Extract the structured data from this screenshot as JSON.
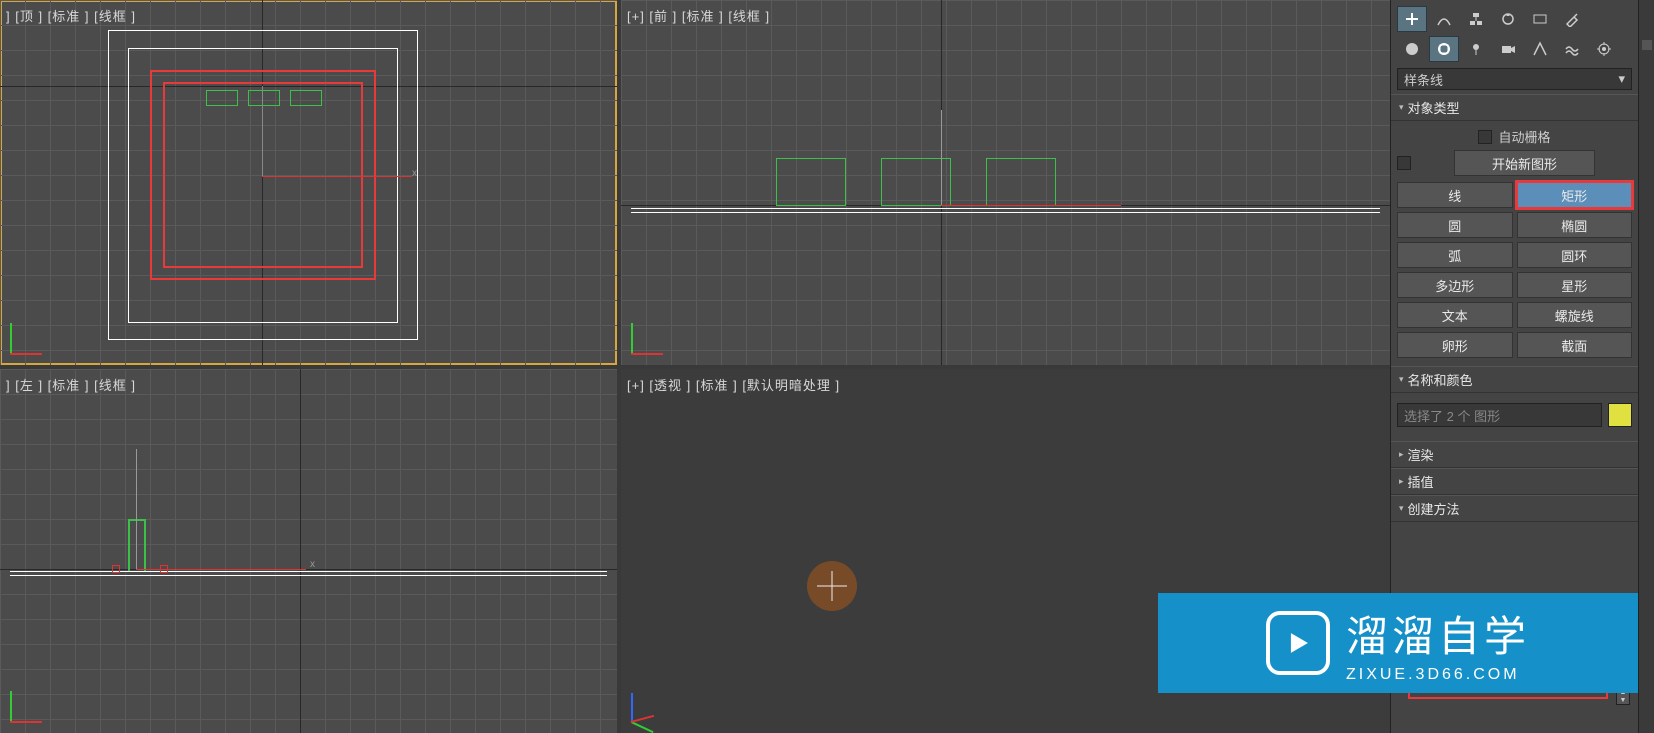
{
  "viewports": {
    "top": {
      "label": "] [顶 ] [标准 ] [线框 ]"
    },
    "front": {
      "label": "[+] [前 ] [标准 ] [线框 ]"
    },
    "left": {
      "label": "] [左 ] [标准 ] [线框 ]"
    },
    "persp": {
      "label": "[+] [透视 ] [标准 ] [默认明暗处理 ]"
    }
  },
  "panel": {
    "dropdown": "样条线",
    "rollout_object_type": "对象类型",
    "auto_grid": "自动栅格",
    "start_new_shape": "开始新图形",
    "buttons": {
      "line": "线",
      "rectangle": "矩形",
      "circle": "圆",
      "ellipse": "椭圆",
      "arc": "弧",
      "donut": "圆环",
      "ngon": "多边形",
      "star": "星形",
      "text": "文本",
      "helix": "螺旋线",
      "egg": "卵形",
      "section": "截面"
    },
    "rollout_name_color": "名称和颜色",
    "name_placeholder": "选择了 2 个 图形",
    "rollout_render": "渲染",
    "rollout_interp": "插值",
    "rollout_create": "创建方法"
  },
  "watermark": {
    "main": "溜溜自学",
    "sub": "ZIXUE.3D66.COM"
  }
}
